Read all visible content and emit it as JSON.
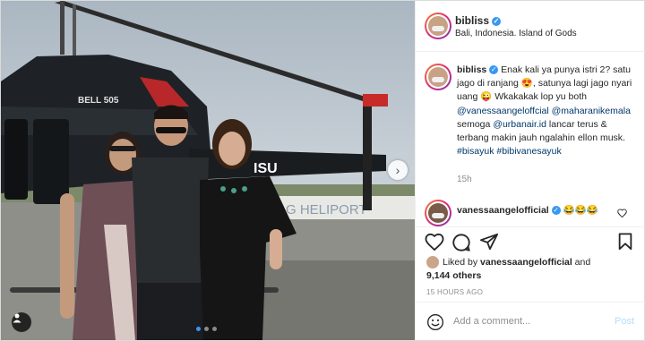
{
  "photo": {
    "heli_text": "BELL 505",
    "sign_text": "G HELIPORT",
    "tail_text": "ISU",
    "carousel_count": 3,
    "carousel_active": 1
  },
  "header": {
    "username": "bibliss",
    "location": "Bali, Indonesia. Island of Gods"
  },
  "caption": {
    "username": "bibliss",
    "text_1": " Enak kali ya punya istri 2? satu jago di ranjang 😍, satunya lagi jago nyari uang 😜 Wkakakak lop yu both ",
    "mention_1": "@vanessaangeloffcial",
    "mention_2": "@maharanikemala",
    "text_2": " semoga ",
    "mention_3": "@urbanair.id",
    "text_3": " lancar terus & terbang makin jauh ngalahin ellon musk. ",
    "hashtag_1": "#bisayuk",
    "hashtag_2": "#bibivanesayuk",
    "time": "15h"
  },
  "comment": {
    "username": "vanessaangelofficial",
    "text": "😂😂😂"
  },
  "likes": {
    "prefix": "Liked by ",
    "user": "vanessaangelofficial",
    "middle": " and",
    "count": "9,144 others"
  },
  "timestamp": "15 HOURS AGO",
  "add_comment": {
    "placeholder": "Add a comment...",
    "post_label": "Post"
  },
  "colors": {
    "accent": "#3897f0",
    "link": "#00376b",
    "muted": "#8e8e8e"
  }
}
